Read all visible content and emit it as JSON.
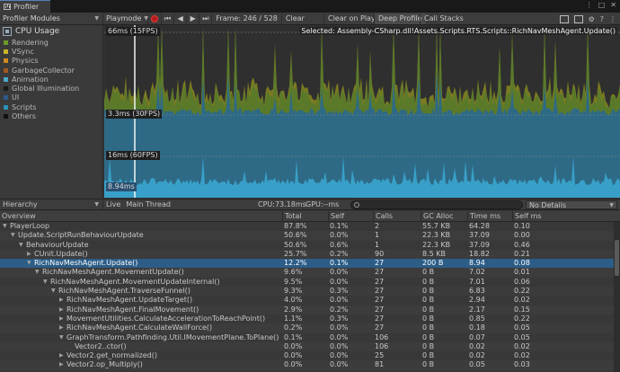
{
  "window": {
    "tab_title": "Profiler",
    "buttons": [
      "⋮",
      "□",
      "✕"
    ]
  },
  "toolbar": {
    "modules_label": "Profiler Modules",
    "mode_label": "Playmode",
    "frame_label": "Frame: 246 / 528",
    "clear_label": "Clear",
    "clear_on_play_label": "Clear on Play",
    "deep_profile_label": "Deep Profile",
    "call_stacks_label": "Call Stacks"
  },
  "modules": {
    "title": "CPU Usage",
    "items": [
      {
        "label": "Rendering",
        "color": "#6a9a2a"
      },
      {
        "label": "VSync",
        "color": "#c8b428"
      },
      {
        "label": "Physics",
        "color": "#d08a20"
      },
      {
        "label": "GarbageCollector",
        "color": "#9c5a28"
      },
      {
        "label": "Animation",
        "color": "#4aa8c8"
      },
      {
        "label": "Global Illumination",
        "color": "#1a1a1a"
      },
      {
        "label": "UI",
        "color": "#2a5a8a"
      },
      {
        "label": "Scripts",
        "color": "#2a90b8"
      },
      {
        "label": "Others",
        "color": "#101010"
      }
    ]
  },
  "chart": {
    "label_66": "66ms (15FPS)",
    "label_33": "3.3ms (30FPS)",
    "label_16": "16ms (60FPS)",
    "label_cur": "8.94ms",
    "selected": "Selected: Assembly-CSharp.dll!Assets.Scripts.RTS.Scripts::RichNavMeshAgent.Update()"
  },
  "hierarchy_bar": {
    "view_label": "Hierarchy",
    "live_label": "Live",
    "thread_label": "Main Thread",
    "cpu_label": "CPU:73.18ms",
    "gpu_label": "GPU:--ms",
    "details_label": "No Details"
  },
  "table": {
    "headers": [
      "Overview",
      "Total",
      "Self",
      "Calls",
      "GC Alloc",
      "Time ms",
      "Self ms"
    ],
    "rows": [
      {
        "depth": 0,
        "tri": "▼",
        "name": "PlayerLoop",
        "total": "87.8%",
        "self": "0.1%",
        "calls": "2",
        "gc": "55.7 KB",
        "time": "64.28",
        "selfms": "0.10"
      },
      {
        "depth": 1,
        "tri": "▼",
        "name": "Update.ScriptRunBehaviourUpdate",
        "total": "50.6%",
        "self": "0.0%",
        "calls": "1",
        "gc": "22.3 KB",
        "time": "37.09",
        "selfms": "0.00"
      },
      {
        "depth": 2,
        "tri": "▼",
        "name": "BehaviourUpdate",
        "total": "50.6%",
        "self": "0.6%",
        "calls": "1",
        "gc": "22.3 KB",
        "time": "37.09",
        "selfms": "0.46"
      },
      {
        "depth": 3,
        "tri": "▶",
        "name": "CUnit.Update()",
        "total": "25.7%",
        "self": "0.2%",
        "calls": "90",
        "gc": "8.5 KB",
        "time": "18.82",
        "selfms": "0.21"
      },
      {
        "depth": 3,
        "tri": "▼",
        "name": "RichNavMeshAgent.Update()",
        "total": "12.2%",
        "self": "0.1%",
        "calls": "27",
        "gc": "200 B",
        "time": "8.94",
        "selfms": "0.08",
        "selected": true
      },
      {
        "depth": 4,
        "tri": "▼",
        "name": "RichNavMeshAgent.MovementUpdate()",
        "total": "9.6%",
        "self": "0.0%",
        "calls": "27",
        "gc": "0 B",
        "time": "7.02",
        "selfms": "0.01"
      },
      {
        "depth": 5,
        "tri": "▼",
        "name": "RichNavMeshAgent.MovementUpdateInternal()",
        "total": "9.5%",
        "self": "0.0%",
        "calls": "27",
        "gc": "0 B",
        "time": "7.01",
        "selfms": "0.06"
      },
      {
        "depth": 6,
        "tri": "▼",
        "name": "RichNavMeshAgent.TraverseFunnel()",
        "total": "9.3%",
        "self": "0.3%",
        "calls": "27",
        "gc": "0 B",
        "time": "6.83",
        "selfms": "0.22"
      },
      {
        "depth": 7,
        "tri": "▶",
        "name": "RichNavMeshAgent.UpdateTarget()",
        "total": "4.0%",
        "self": "0.0%",
        "calls": "27",
        "gc": "0 B",
        "time": "2.94",
        "selfms": "0.02"
      },
      {
        "depth": 7,
        "tri": "▶",
        "name": "RichNavMeshAgent.FinalMovement()",
        "total": "2.9%",
        "self": "0.2%",
        "calls": "27",
        "gc": "0 B",
        "time": "2.17",
        "selfms": "0.15"
      },
      {
        "depth": 7,
        "tri": "▶",
        "name": "MovementUtilities.CalculateAccelerationToReachPoint()",
        "total": "1.1%",
        "self": "0.3%",
        "calls": "27",
        "gc": "0 B",
        "time": "0.85",
        "selfms": "0.22"
      },
      {
        "depth": 7,
        "tri": "▶",
        "name": "RichNavMeshAgent.CalculateWallForce()",
        "total": "0.2%",
        "self": "0.0%",
        "calls": "27",
        "gc": "0 B",
        "time": "0.18",
        "selfms": "0.05"
      },
      {
        "depth": 7,
        "tri": "▼",
        "name": "GraphTransform.Pathfinding.Util.IMovementPlane.ToPlane()",
        "total": "0.1%",
        "self": "0.0%",
        "calls": "106",
        "gc": "0 B",
        "time": "0.07",
        "selfms": "0.05"
      },
      {
        "depth": 8,
        "tri": "",
        "name": "Vector2..ctor()",
        "total": "0.0%",
        "self": "0.0%",
        "calls": "106",
        "gc": "0 B",
        "time": "0.02",
        "selfms": "0.02"
      },
      {
        "depth": 7,
        "tri": "▶",
        "name": "Vector2.get_normalized()",
        "total": "0.0%",
        "self": "0.0%",
        "calls": "25",
        "gc": "0 B",
        "time": "0.02",
        "selfms": "0.02"
      },
      {
        "depth": 7,
        "tri": "▶",
        "name": "Vector2.op_Multiply()",
        "total": "0.0%",
        "self": "0.0%",
        "calls": "81",
        "gc": "0 B",
        "time": "0.05",
        "selfms": "0.03"
      }
    ]
  }
}
